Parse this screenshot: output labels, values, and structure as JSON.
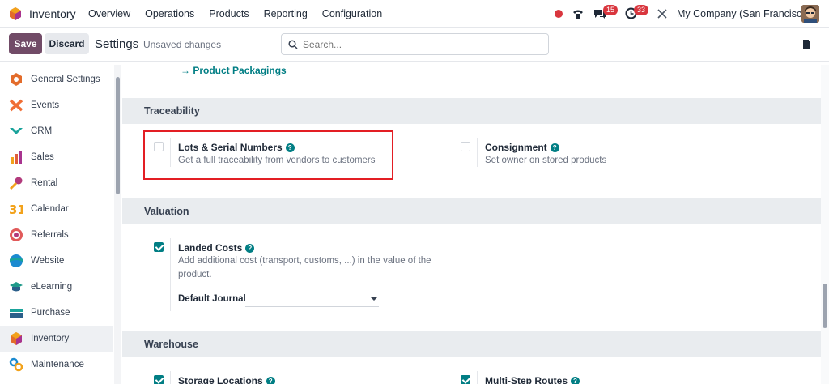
{
  "topbar": {
    "app_name": "Inventory",
    "menu": [
      "Overview",
      "Operations",
      "Products",
      "Reporting",
      "Configuration"
    ],
    "chat_badge": "15",
    "activity_badge": "33",
    "company": "My Company (San Francisco)"
  },
  "controlbar": {
    "save_label": "Save",
    "discard_label": "Discard",
    "title": "Settings",
    "status": "Unsaved changes",
    "search_placeholder": "Search..."
  },
  "sidebar": {
    "items": [
      {
        "label": "General Settings",
        "icon": "general-settings-icon",
        "color": "#e36c2b"
      },
      {
        "label": "Events",
        "icon": "events-icon",
        "color": "#f06e35"
      },
      {
        "label": "CRM",
        "icon": "crm-icon",
        "color": "#1aa39b"
      },
      {
        "label": "Sales",
        "icon": "sales-icon",
        "color": "#e05e3b"
      },
      {
        "label": "Rental",
        "icon": "rental-icon",
        "color": "#b23a7c"
      },
      {
        "label": "Calendar",
        "icon": "calendar-icon",
        "color": "#f2a21b"
      },
      {
        "label": "Referrals",
        "icon": "referrals-icon",
        "color": "#e15a5a"
      },
      {
        "label": "Website",
        "icon": "website-icon",
        "color": "#1b8ad0"
      },
      {
        "label": "eLearning",
        "icon": "elearning-icon",
        "color": "#1f9a8a"
      },
      {
        "label": "Purchase",
        "icon": "purchase-icon",
        "color": "#2b5f8a"
      },
      {
        "label": "Inventory",
        "icon": "inventory-icon",
        "color": "#e36c2b"
      },
      {
        "label": "Maintenance",
        "icon": "maintenance-icon",
        "color": "#1b8ad0"
      }
    ],
    "active": "Inventory"
  },
  "main": {
    "link": "Product Packagings",
    "sections": {
      "traceability": "Traceability",
      "valuation": "Valuation",
      "warehouse": "Warehouse"
    },
    "lots": {
      "title": "Lots & Serial Numbers",
      "desc": "Get a full traceability from vendors to customers",
      "checked": false
    },
    "consignment": {
      "title": "Consignment",
      "desc": "Set owner on stored products",
      "checked": false
    },
    "landed": {
      "title": "Landed Costs",
      "desc": "Add additional cost (transport, customs, ...) in the value of the product.",
      "checked": true,
      "journal_label": "Default Journal"
    },
    "storage": {
      "title": "Storage Locations",
      "checked": true
    },
    "multistep": {
      "title": "Multi-Step Routes",
      "checked": true
    }
  },
  "colors": {
    "brand": "#714b67",
    "accent": "#017e84",
    "highlight": "#e31e24"
  }
}
